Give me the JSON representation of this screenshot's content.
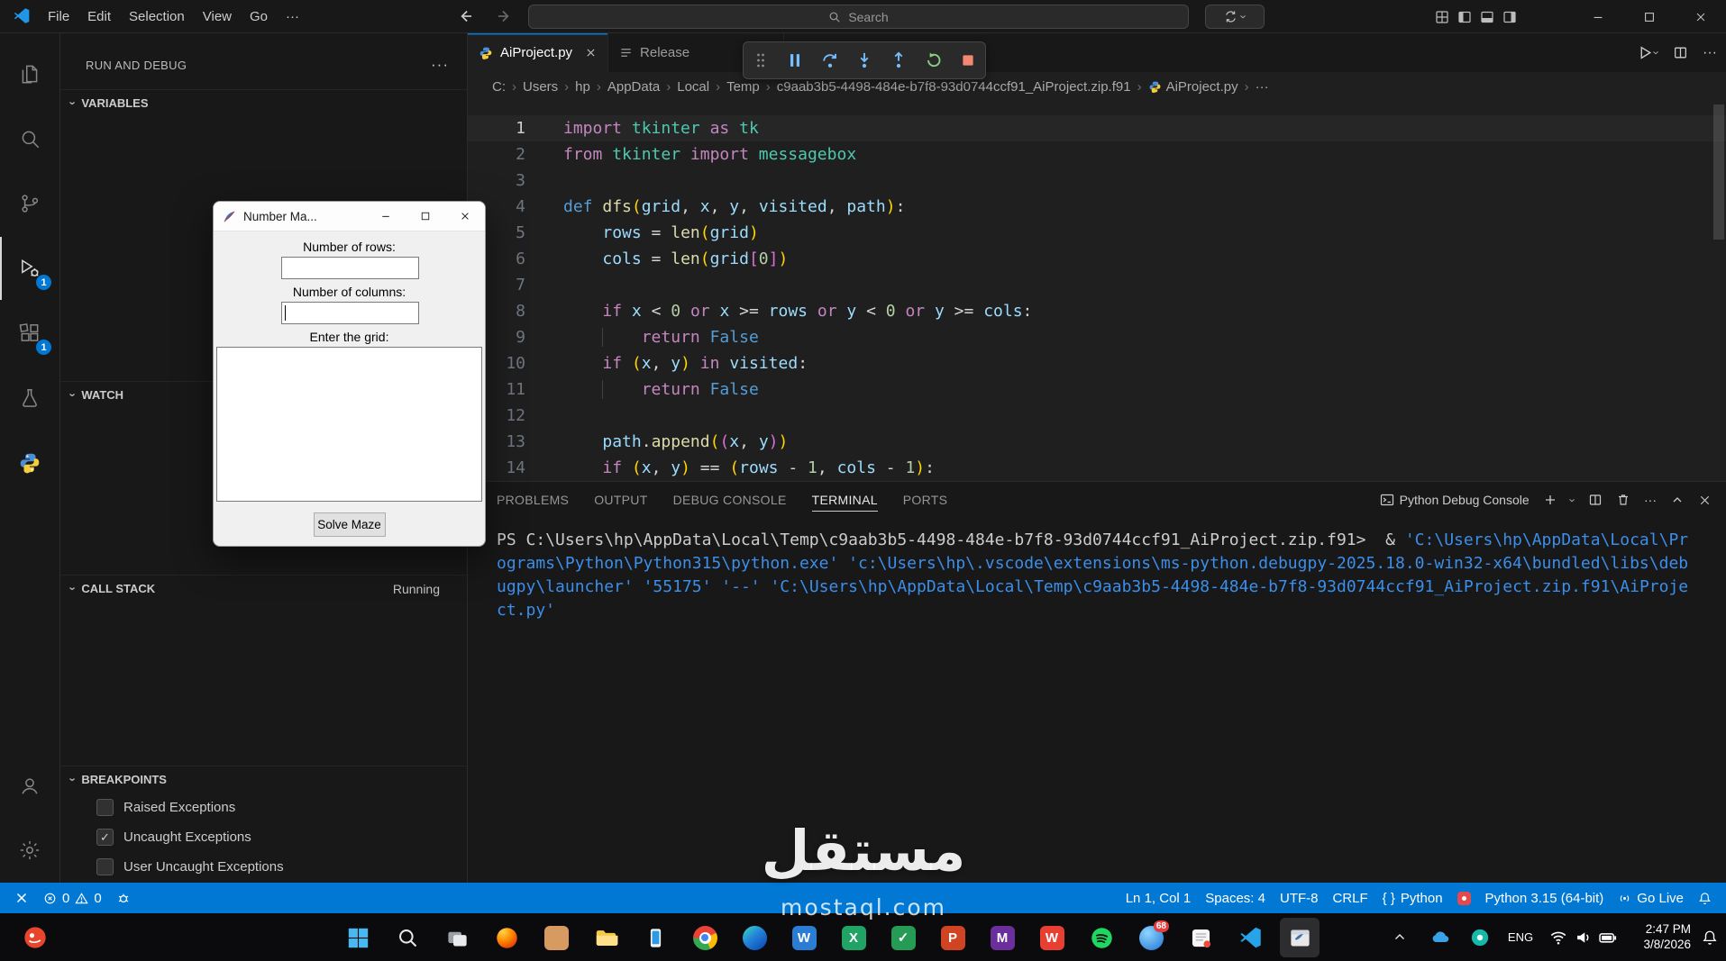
{
  "titlebar": {
    "menus": [
      "File",
      "Edit",
      "Selection",
      "View",
      "Go"
    ],
    "more": "···",
    "search_placeholder": "Search"
  },
  "activity_bar": {
    "debug_badge": "1",
    "extensions_badge": "1"
  },
  "sidebar": {
    "title": "RUN AND DEBUG",
    "more": "···",
    "sections": {
      "variables": "VARIABLES",
      "watch": "WATCH",
      "call_stack": "CALL STACK",
      "call_stack_status": "Running",
      "breakpoints": "BREAKPOINTS"
    },
    "breakpoints": [
      {
        "label": "Raised Exceptions",
        "checked": false
      },
      {
        "label": "Uncaught Exceptions",
        "checked": true
      },
      {
        "label": "User Uncaught Exceptions",
        "checked": false
      }
    ]
  },
  "dialog": {
    "title": "Number Ma...",
    "rows_label": "Number of rows:",
    "cols_label": "Number of columns:",
    "grid_label": "Enter the grid:",
    "rows_value": "",
    "cols_value": "",
    "grid_value": "",
    "solve_button": "Solve Maze"
  },
  "editor": {
    "tabs": [
      {
        "label": "AiProject.py"
      },
      {
        "label": "Release"
      }
    ],
    "breadcrumb": [
      {
        "t": "C:"
      },
      {
        "t": "Users"
      },
      {
        "t": "hp"
      },
      {
        "t": "AppData"
      },
      {
        "t": "Local"
      },
      {
        "t": "Temp"
      },
      {
        "t": "c9aab3b5-4498-484e-b7f8-93d0744ccf91_AiProject.zip.f91"
      },
      {
        "t": "AiProject.py",
        "icon": "python"
      },
      {
        "t": "···"
      }
    ],
    "code_lines": [
      {
        "n": 1,
        "active": true,
        "t": [
          [
            "kw",
            "import"
          ],
          [
            "pl",
            " "
          ],
          [
            "cl",
            "tkinter"
          ],
          [
            "pl",
            " "
          ],
          [
            "kw",
            "as"
          ],
          [
            "pl",
            " "
          ],
          [
            "cl",
            "tk"
          ]
        ]
      },
      {
        "n": 2,
        "t": [
          [
            "kw",
            "from"
          ],
          [
            "pl",
            " "
          ],
          [
            "cl",
            "tkinter"
          ],
          [
            "pl",
            " "
          ],
          [
            "kw",
            "import"
          ],
          [
            "pl",
            " "
          ],
          [
            "cl",
            "messagebox"
          ]
        ]
      },
      {
        "n": 3,
        "t": []
      },
      {
        "n": 4,
        "t": [
          [
            "kb",
            "def"
          ],
          [
            "pl",
            " "
          ],
          [
            "fn",
            "dfs"
          ],
          [
            "b1",
            "("
          ],
          [
            "vr",
            "grid"
          ],
          [
            "pl",
            ", "
          ],
          [
            "vr",
            "x"
          ],
          [
            "pl",
            ", "
          ],
          [
            "vr",
            "y"
          ],
          [
            "pl",
            ", "
          ],
          [
            "vr",
            "visited"
          ],
          [
            "pl",
            ", "
          ],
          [
            "vr",
            "path"
          ],
          [
            "b1",
            ")"
          ],
          [
            "pl",
            ":"
          ]
        ]
      },
      {
        "n": 5,
        "t": [
          [
            "pl",
            "    "
          ],
          [
            "vr",
            "rows"
          ],
          [
            "pl",
            " = "
          ],
          [
            "fn",
            "len"
          ],
          [
            "b1",
            "("
          ],
          [
            "vr",
            "grid"
          ],
          [
            "b1",
            ")"
          ]
        ]
      },
      {
        "n": 6,
        "t": [
          [
            "pl",
            "    "
          ],
          [
            "vr",
            "cols"
          ],
          [
            "pl",
            " = "
          ],
          [
            "fn",
            "len"
          ],
          [
            "b1",
            "("
          ],
          [
            "vr",
            "grid"
          ],
          [
            "b2",
            "["
          ],
          [
            "nu",
            "0"
          ],
          [
            "b2",
            "]"
          ],
          [
            "b1",
            ")"
          ]
        ]
      },
      {
        "n": 7,
        "t": []
      },
      {
        "n": 8,
        "t": [
          [
            "pl",
            "    "
          ],
          [
            "kw",
            "if"
          ],
          [
            "pl",
            " "
          ],
          [
            "vr",
            "x"
          ],
          [
            "pl",
            " < "
          ],
          [
            "nu",
            "0"
          ],
          [
            "pl",
            " "
          ],
          [
            "kw",
            "or"
          ],
          [
            "pl",
            " "
          ],
          [
            "vr",
            "x"
          ],
          [
            "pl",
            " >= "
          ],
          [
            "vr",
            "rows"
          ],
          [
            "pl",
            " "
          ],
          [
            "kw",
            "or"
          ],
          [
            "pl",
            " "
          ],
          [
            "vr",
            "y"
          ],
          [
            "pl",
            " < "
          ],
          [
            "nu",
            "0"
          ],
          [
            "pl",
            " "
          ],
          [
            "kw",
            "or"
          ],
          [
            "pl",
            " "
          ],
          [
            "vr",
            "y"
          ],
          [
            "pl",
            " >= "
          ],
          [
            "vr",
            "cols"
          ],
          [
            "pl",
            ":"
          ]
        ]
      },
      {
        "n": 9,
        "t": [
          [
            "pl",
            "    "
          ],
          [
            "gd",
            "    "
          ],
          [
            "kw",
            "return"
          ],
          [
            "pl",
            " "
          ],
          [
            "kb",
            "False"
          ]
        ]
      },
      {
        "n": 10,
        "t": [
          [
            "pl",
            "    "
          ],
          [
            "kw",
            "if"
          ],
          [
            "pl",
            " "
          ],
          [
            "b1",
            "("
          ],
          [
            "vr",
            "x"
          ],
          [
            "pl",
            ", "
          ],
          [
            "vr",
            "y"
          ],
          [
            "b1",
            ")"
          ],
          [
            "pl",
            " "
          ],
          [
            "kw",
            "in"
          ],
          [
            "pl",
            " "
          ],
          [
            "vr",
            "visited"
          ],
          [
            "pl",
            ":"
          ]
        ]
      },
      {
        "n": 11,
        "t": [
          [
            "pl",
            "    "
          ],
          [
            "gd",
            "    "
          ],
          [
            "kw",
            "return"
          ],
          [
            "pl",
            " "
          ],
          [
            "kb",
            "False"
          ]
        ]
      },
      {
        "n": 12,
        "t": []
      },
      {
        "n": 13,
        "t": [
          [
            "pl",
            "    "
          ],
          [
            "vr",
            "path"
          ],
          [
            "pl",
            "."
          ],
          [
            "fn",
            "append"
          ],
          [
            "b1",
            "("
          ],
          [
            "b2",
            "("
          ],
          [
            "vr",
            "x"
          ],
          [
            "pl",
            ", "
          ],
          [
            "vr",
            "y"
          ],
          [
            "b2",
            ")"
          ],
          [
            "b1",
            ")"
          ]
        ]
      },
      {
        "n": 14,
        "t": [
          [
            "pl",
            "    "
          ],
          [
            "kw",
            "if"
          ],
          [
            "pl",
            " "
          ],
          [
            "b1",
            "("
          ],
          [
            "vr",
            "x"
          ],
          [
            "pl",
            ", "
          ],
          [
            "vr",
            "y"
          ],
          [
            "b1",
            ")"
          ],
          [
            "pl",
            " == "
          ],
          [
            "b1",
            "("
          ],
          [
            "vr",
            "rows"
          ],
          [
            "pl",
            " - "
          ],
          [
            "nu",
            "1"
          ],
          [
            "pl",
            ", "
          ],
          [
            "vr",
            "cols"
          ],
          [
            "pl",
            " - "
          ],
          [
            "nu",
            "1"
          ],
          [
            "b1",
            ")"
          ],
          [
            "pl",
            ":"
          ]
        ]
      }
    ]
  },
  "panel": {
    "tabs": [
      "PROBLEMS",
      "OUTPUT",
      "DEBUG CONSOLE",
      "TERMINAL",
      "PORTS"
    ],
    "console_label": "Python Debug Console",
    "terminal_lines": [
      [
        [
          "t",
          "PS C:\\Users\\hp\\AppData\\Local\\Temp\\c9aab3b5-4498-484e-b7f8-93d0744ccf91_AiProject.zip.f91>  & "
        ],
        [
          "s",
          "'C:\\Users\\hp\\AppData\\Local\\Pr"
        ]
      ],
      [
        [
          "s",
          "ograms\\Python\\Python315\\python.exe'"
        ],
        [
          "t",
          " "
        ],
        [
          "s",
          "'c:\\Users\\hp\\.vscode\\extensions\\ms-python.debugpy-2025.18.0-win32-x64\\bundled\\libs\\deb"
        ]
      ],
      [
        [
          "s",
          "ugpy\\launcher'"
        ],
        [
          "t",
          " "
        ],
        [
          "s",
          "'55175'"
        ],
        [
          "t",
          " "
        ],
        [
          "s",
          "'--'"
        ],
        [
          "t",
          " "
        ],
        [
          "s",
          "'C:\\Users\\hp\\AppData\\Local\\Temp\\c9aab3b5-4498-484e-b7f8-93d0744ccf91_AiProject.zip.f91\\AiProje"
        ]
      ],
      [
        [
          "s",
          "ct.py'"
        ]
      ]
    ]
  },
  "status_bar": {
    "errors": "0",
    "warnings": "0",
    "cursor": "Ln 1, Col 1",
    "indent": "Spaces: 4",
    "encoding": "UTF-8",
    "eol": "CRLF",
    "language_icon": "{ }",
    "language": "Python",
    "interpreter": "Python 3.15 (64-bit)",
    "go_live": "Go Live"
  },
  "taskbar": {
    "language": "ENG",
    "time": "2:47 PM",
    "date": "3/8/2026",
    "apps": [
      {
        "id": "start"
      },
      {
        "id": "search"
      },
      {
        "id": "task-view"
      },
      {
        "id": "firefox"
      },
      {
        "id": "app-tan",
        "color": "#d79b62"
      },
      {
        "id": "file-explorer"
      },
      {
        "id": "phone-link"
      },
      {
        "id": "chrome"
      },
      {
        "id": "edge"
      },
      {
        "id": "word",
        "letter": "W",
        "color": "#2b7cd3"
      },
      {
        "id": "excel",
        "letter": "X",
        "color": "#21a366"
      },
      {
        "id": "todo",
        "letter": "✓",
        "color": "#259b55"
      },
      {
        "id": "powerpoint",
        "letter": "P",
        "color": "#d04423"
      },
      {
        "id": "m365",
        "letter": "M",
        "color": "#6b2f9c"
      },
      {
        "id": "wps",
        "letter": "W",
        "color": "#e74033"
      },
      {
        "id": "spotify"
      },
      {
        "id": "badge-app",
        "badge": "68"
      },
      {
        "id": "notes"
      },
      {
        "id": "vscode"
      },
      {
        "id": "tkinter-app",
        "active": true
      }
    ]
  },
  "watermark": {
    "arabic": "مستقل",
    "latin": "mostaql.com"
  }
}
